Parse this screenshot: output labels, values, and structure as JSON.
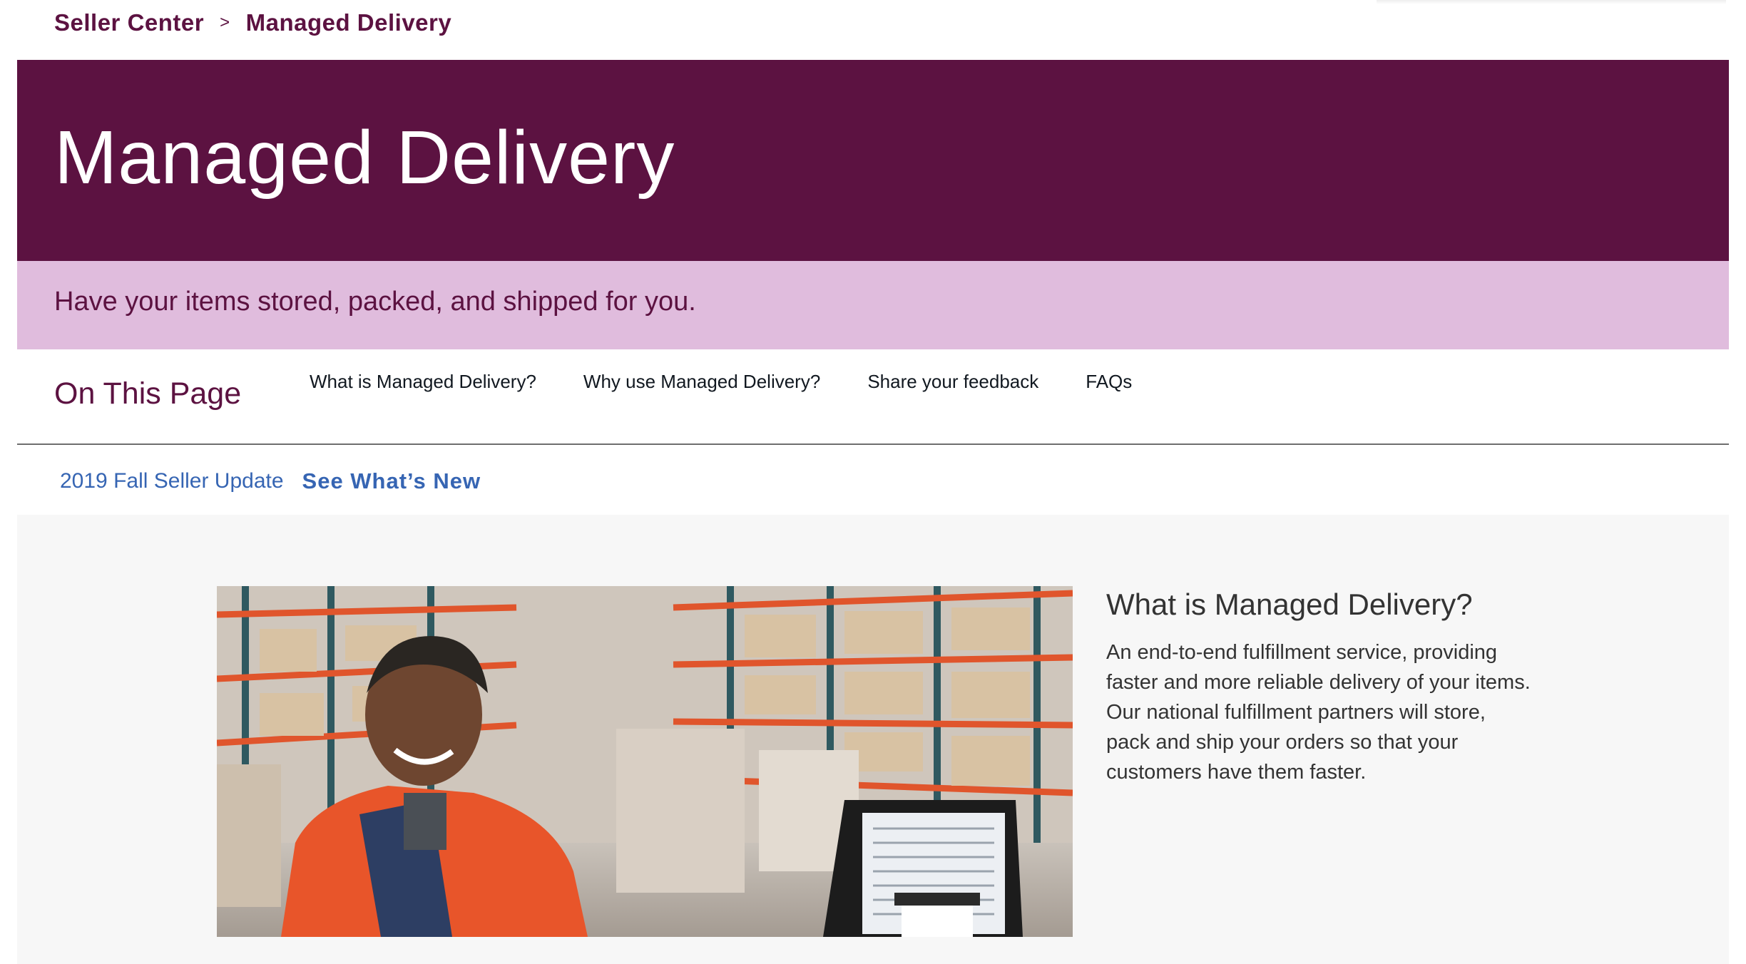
{
  "breadcrumb": {
    "root": "Seller Center",
    "separator": ">",
    "current": "Managed Delivery"
  },
  "hero": {
    "title": "Managed Delivery",
    "subtitle": "Have your items stored, packed, and shipped for you."
  },
  "on_this_page": {
    "title": "On This Page",
    "links": [
      "What is Managed Delivery?",
      "Why use Managed Delivery?",
      "Share your feedback",
      "FAQs"
    ]
  },
  "update_bar": {
    "label": "2019 Fall Seller Update",
    "link": "See What’s New"
  },
  "section": {
    "heading": "What is Managed Delivery?",
    "body": "An end-to-end fulfillment service, providing faster and more reliable delivery of your items. Our national fulfillment partners will store, pack and ship your orders so that your customers have them faster."
  },
  "colors": {
    "brand_plum": "#5c1241",
    "banner_lilac": "#e0bcdd",
    "link_blue": "#3665b3",
    "section_bg": "#f7f7f7"
  }
}
